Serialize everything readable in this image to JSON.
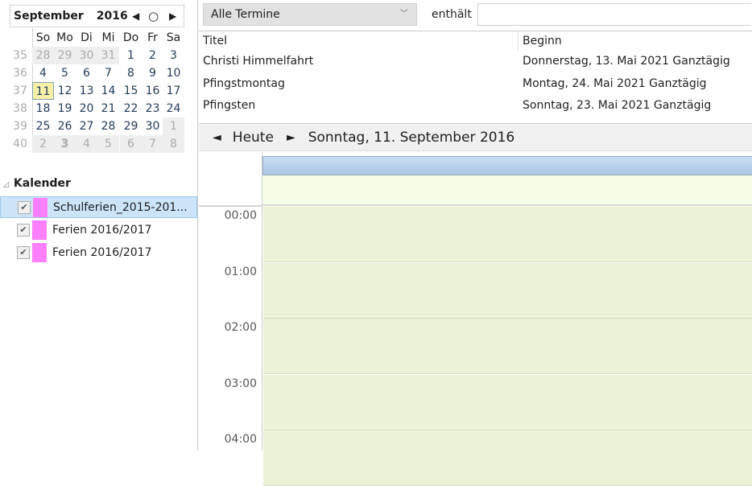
{
  "mini_calendar": {
    "month": "September",
    "year": "2016",
    "weekday_headers": [
      "So",
      "Mo",
      "Di",
      "Mi",
      "Do",
      "Fr",
      "Sa"
    ],
    "weeks": [
      {
        "num": "35",
        "days": [
          "28",
          "29",
          "30",
          "31",
          "1",
          "2",
          "3"
        ]
      },
      {
        "num": "36",
        "days": [
          "4",
          "5",
          "6",
          "7",
          "8",
          "9",
          "10"
        ]
      },
      {
        "num": "37",
        "days": [
          "11",
          "12",
          "13",
          "14",
          "15",
          "16",
          "17"
        ]
      },
      {
        "num": "38",
        "days": [
          "18",
          "19",
          "20",
          "21",
          "22",
          "23",
          "24"
        ]
      },
      {
        "num": "39",
        "days": [
          "25",
          "26",
          "27",
          "28",
          "29",
          "30",
          "1"
        ]
      },
      {
        "num": "40",
        "days": [
          "2",
          "3",
          "4",
          "5",
          "6",
          "7",
          "8"
        ]
      }
    ],
    "selected_day": "11"
  },
  "calendars": {
    "header": "Kalender",
    "items": [
      {
        "label": "Schulferien_2015-201...",
        "checked": true,
        "color": "#ff80ff"
      },
      {
        "label": "Ferien 2016/2017",
        "checked": true,
        "color": "#ff80ff"
      },
      {
        "label": "Ferien 2016/2017",
        "checked": true,
        "color": "#ff80ff"
      }
    ]
  },
  "filter": {
    "selected": "Alle Termine",
    "contains_label": "enthält",
    "search_value": ""
  },
  "events_table": {
    "columns": [
      "Titel",
      "Beginn"
    ],
    "rows": [
      [
        "Christi Himmelfahrt",
        "Donnerstag, 13. Mai 2021 Ganztägig"
      ],
      [
        "Pfingstmontag",
        "Montag, 24. Mai 2021 Ganztägig"
      ],
      [
        "Pfingsten",
        "Sonntag, 23. Mai 2021 Ganztägig"
      ]
    ]
  },
  "day_nav": {
    "prev": "◄",
    "today": "Heute",
    "next": "►",
    "date": "Sonntag, 11. September 2016"
  },
  "hours": [
    "00:00",
    "01:00",
    "02:00",
    "03:00",
    "04:00"
  ]
}
